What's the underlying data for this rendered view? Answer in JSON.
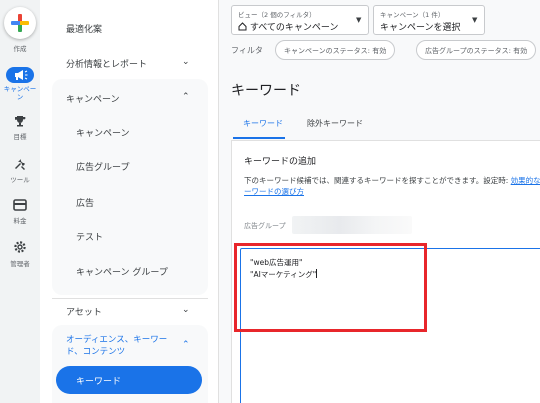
{
  "rail": {
    "create_label": "作成",
    "items": [
      {
        "label": "キャンペー\nン",
        "icon": "megaphone-icon",
        "active": true
      },
      {
        "label": "目標",
        "icon": "trophy-icon"
      },
      {
        "label": "ツール",
        "icon": "tools-icon"
      },
      {
        "label": "料金",
        "icon": "billing-icon"
      },
      {
        "label": "管理者",
        "icon": "gear-icon"
      }
    ]
  },
  "nav": {
    "top_items": [
      "最適化案",
      "分析情報とレポート"
    ],
    "campaign_group": {
      "header": "キャンペーン",
      "items": [
        "キャンペーン",
        "広告グループ",
        "広告",
        "テスト",
        "キャンペーン グループ"
      ]
    },
    "assets": "アセット",
    "audience_group": {
      "header_line1": "オーディエンス、キーワー",
      "header_line2": "ド、コンテンツ",
      "active_item": "キーワード"
    }
  },
  "toolbar": {
    "view_small": "ビュー（2 個のフィルタ）",
    "view_main": "すべてのキャンペーン",
    "campaign_small": "キャンペーン（1 件）",
    "campaign_main": "キャンペーンを選択",
    "filter_label": "フィルタ",
    "chips": [
      "キャンペーンのステータス: 有効",
      "広告グループのステータス: 有効"
    ]
  },
  "page": {
    "title": "キーワード",
    "tabs": [
      "キーワード",
      "除外キーワード"
    ],
    "active_tab": 0
  },
  "card": {
    "title": "キーワードの追加",
    "desc_text": "下のキーワード候補では、関連するキーワードを探すことができます。設定時: ",
    "desc_link": "効果的なキーワードの選び方",
    "adgroup_label": "広告グループ",
    "keywords_line1": "\"web広告運用\"",
    "keywords_line2": "\"AIマーケティング\""
  },
  "colors": {
    "accent": "#1a73e8",
    "highlight": "#e8262b"
  }
}
